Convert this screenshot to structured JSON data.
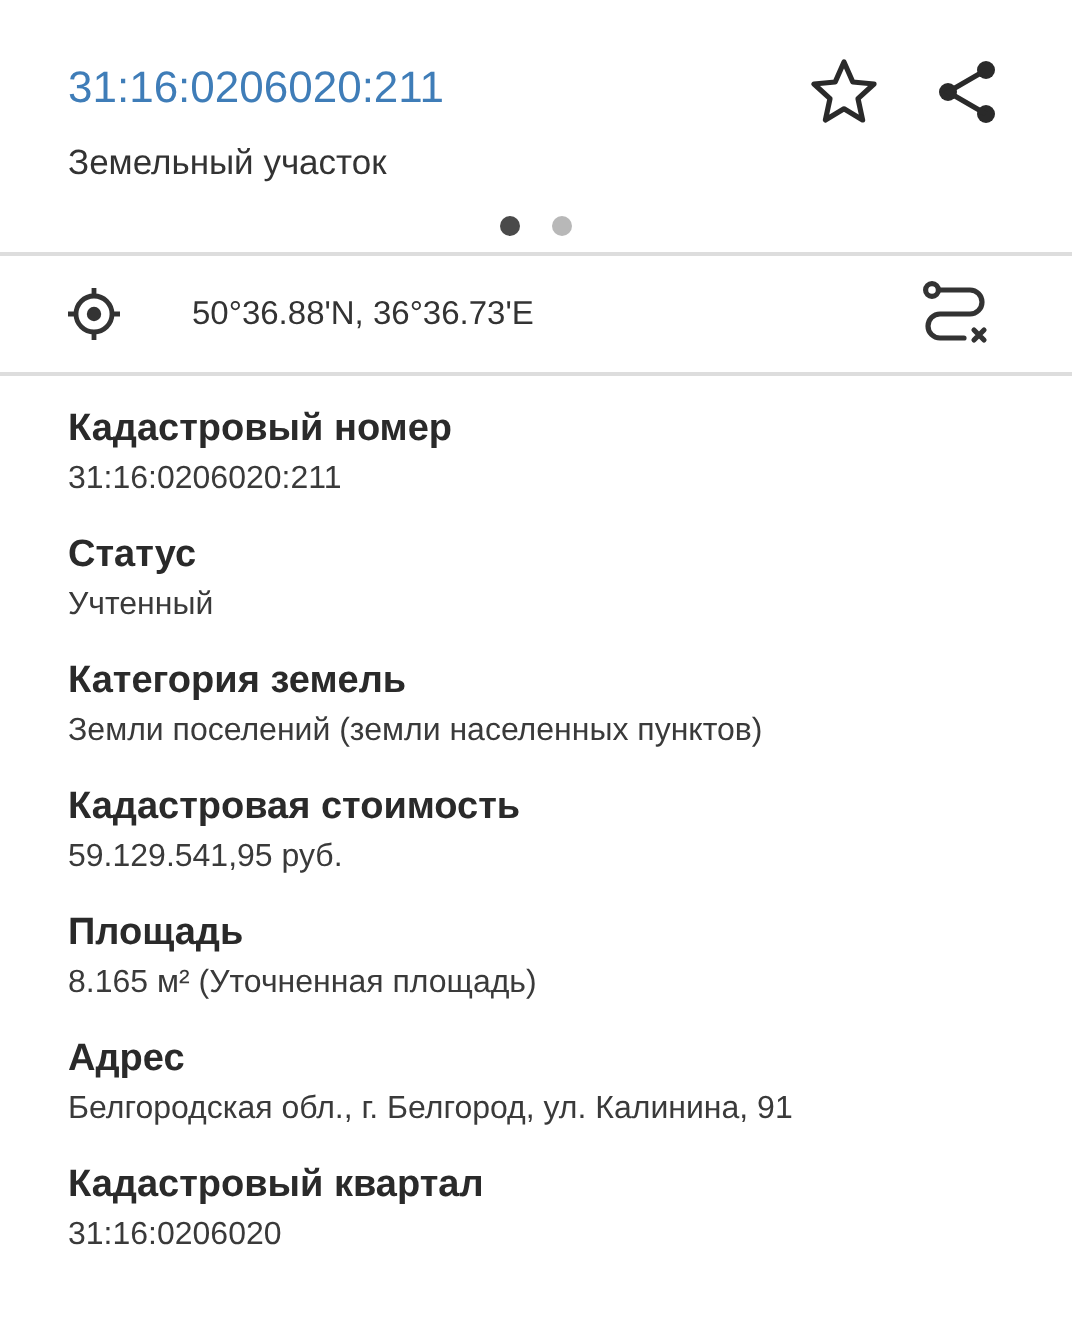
{
  "header": {
    "title": "31:16:0206020:211",
    "subtitle": "Земельный участок"
  },
  "pager": [
    {
      "selected": true
    },
    {
      "selected": false
    }
  ],
  "location": {
    "coordinates": "50°36.88'N, 36°36.73'E"
  },
  "fields": [
    {
      "label": "Кадастровый номер",
      "value": "31:16:0206020:211"
    },
    {
      "label": "Статус",
      "value": "Учтенный"
    },
    {
      "label": "Категория земель",
      "value": "Земли поселений (земли населенных пунктов)"
    },
    {
      "label": "Кадастровая стоимость",
      "value": "59.129.541,95 руб."
    },
    {
      "label": "Площадь",
      "value": "8.165 м² (Уточненная площадь)"
    },
    {
      "label": "Адрес",
      "value": "Белгородская обл., г. Белгород, ул. Калинина, 91"
    },
    {
      "label": "Кадастровый квартал",
      "value": "31:16:0206020"
    }
  ]
}
